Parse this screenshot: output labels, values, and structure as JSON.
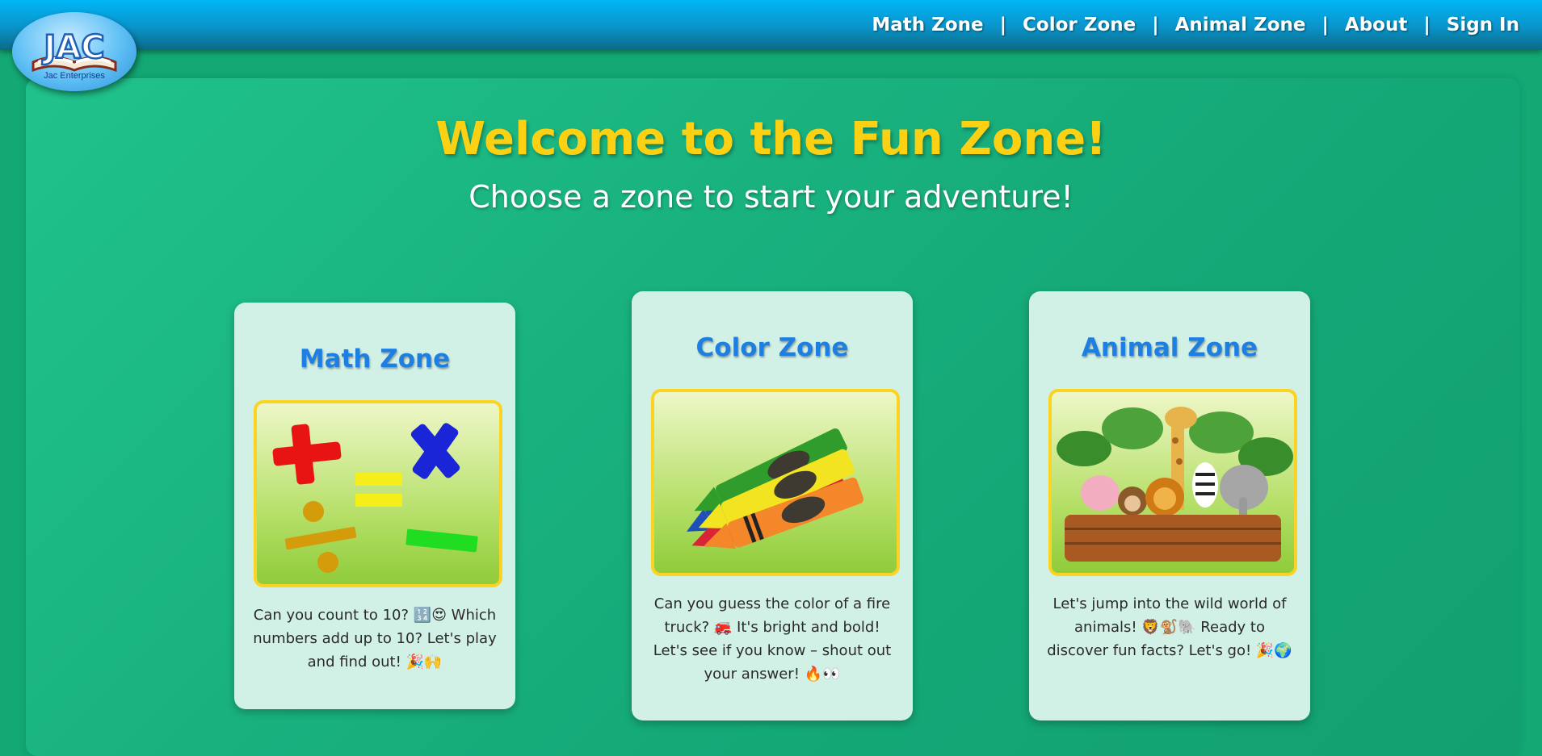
{
  "logo": {
    "text": "JAC",
    "subtitle": "Jac Enterprises"
  },
  "nav": {
    "items": [
      "Math Zone",
      "Color Zone",
      "Animal Zone",
      "About",
      "Sign In"
    ],
    "separator": "|"
  },
  "hero": {
    "title": "Welcome to the Fun Zone!",
    "subtitle": "Choose a zone to start your adventure!"
  },
  "cards": [
    {
      "title": "Math Zone",
      "image": "math-symbols-image",
      "text": "Can you count to 10? 🔢😍 Which numbers add up to 10? Let's play and find out! 🎉🙌"
    },
    {
      "title": "Color Zone",
      "image": "crayons-image",
      "text": "Can you guess the color of a fire truck? 🚒 It's bright and bold! Let's see if you know – shout out your answer! 🔥👀"
    },
    {
      "title": "Animal Zone",
      "image": "jungle-animals-image",
      "text": "Let's jump into the wild world of animals! 🦁🐒🐘 Ready to discover fun facts? Let's go! 🎉🌍"
    }
  ],
  "colors": {
    "accent": "#fcd113",
    "card_title": "#1e7fe2",
    "background": "#13a874",
    "header": "#0a93c9"
  }
}
